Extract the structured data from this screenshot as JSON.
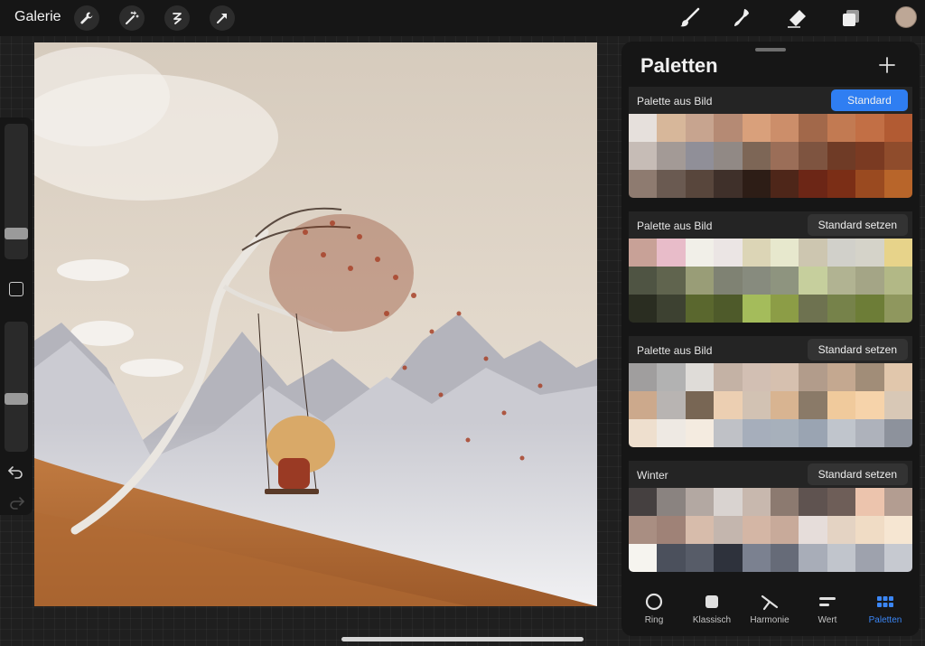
{
  "topbar": {
    "gallery_label": "Galerie",
    "left_tools": [
      "wrench-icon",
      "magic-wand-icon",
      "selection-icon",
      "transform-arrow-icon"
    ],
    "right_tools": [
      "brush-icon",
      "smudge-icon",
      "eraser-icon",
      "layers-icon"
    ],
    "current_color": "#bda796"
  },
  "sidebar": {
    "brush_size_level": 0.16,
    "opacity_level": 0.4
  },
  "panel": {
    "title": "Paletten",
    "palettes": [
      {
        "name": "Palette aus Bild",
        "button": "Standard",
        "is_default": true,
        "colors": [
          "#e6e0dc",
          "#d7b79a",
          "#c7a48f",
          "#b58a74",
          "#d9a07b",
          "#cc8e6a",
          "#a2684a",
          "#c27a52",
          "#c26f45",
          "#b25b33",
          "#c6bcb6",
          "#a39a96",
          "#908f98",
          "#918985",
          "#7d6656",
          "#9b6e58",
          "#7e5440",
          "#6f3b26",
          "#7a3a22",
          "#8f4c2c",
          "#8e7b70",
          "#6a5a51",
          "#58463c",
          "#3f302a",
          "#2d1d16",
          "#4e2619",
          "#6c2616",
          "#7b2e16",
          "#9a4a20",
          "#b8652a"
        ]
      },
      {
        "name": "Palette aus Bild",
        "button": "Standard setzen",
        "is_default": false,
        "colors": [
          "#c8a197",
          "#e8bcc9",
          "#f1efe8",
          "#ebe5e4",
          "#dcd5b6",
          "#e7e8cd",
          "#cdc6b0",
          "#d1d0ca",
          "#d5d3c9",
          "#e7d38a",
          "#4f5443",
          "#60644e",
          "#999d77",
          "#7f8273",
          "#878b7e",
          "#8e947f",
          "#c6cf9d",
          "#b1b392",
          "#a4a586",
          "#b2b886",
          "#2a2d21",
          "#3d4131",
          "#5a672e",
          "#4e5a2a",
          "#a4bc5b",
          "#8c9d46",
          "#6e7250",
          "#76824a",
          "#6d7d37",
          "#8f975e"
        ]
      },
      {
        "name": "Palette aus Bild",
        "button": "Standard setzen",
        "is_default": false,
        "colors": [
          "#a09e9e",
          "#b2b2b2",
          "#dfdcd8",
          "#c4b2a5",
          "#d2bfb3",
          "#d6c0af",
          "#b29c8b",
          "#c4a890",
          "#a18d78",
          "#e1c7ac",
          "#cca98c",
          "#b8b4b2",
          "#786654",
          "#eccfb2",
          "#d2c2b3",
          "#d8b491",
          "#8a7a68",
          "#f0ca9c",
          "#f6d3aa",
          "#d8c8b6",
          "#eedfce",
          "#eee9e3",
          "#f4ebe0",
          "#bfc1c6",
          "#a6aebb",
          "#a7b0bb",
          "#9aa4b2",
          "#c0c5cc",
          "#aeb2bb",
          "#8d929c"
        ]
      },
      {
        "name": "Winter",
        "button": "Standard setzen",
        "is_default": false,
        "colors": [
          "#454040",
          "#8a8380",
          "#b3a8a2",
          "#d9d3d0",
          "#c8b8ae",
          "#8c7a70",
          "#5f5350",
          "#6e5e58",
          "#ecc4ad",
          "#b39d91",
          "#a98e82",
          "#9f8277",
          "#d7bcab",
          "#c4b6ae",
          "#d4b6a5",
          "#c8aa9a",
          "#e6ddda",
          "#e4d3c3",
          "#f0dcc5",
          "#f6e6d2",
          "#f6f4ef",
          "#4b505c",
          "#575c68",
          "#2e323c",
          "#7b8190",
          "#666b78",
          "#a8adb8",
          "#c1c5cc",
          "#9ea2ad",
          "#c6c9d0"
        ]
      }
    ],
    "tabs": [
      {
        "label": "Ring",
        "icon": "ring-icon"
      },
      {
        "label": "Klassisch",
        "icon": "classic-square-icon"
      },
      {
        "label": "Harmonie",
        "icon": "harmony-icon"
      },
      {
        "label": "Wert",
        "icon": "value-sliders-icon"
      },
      {
        "label": "Paletten",
        "icon": "palettes-grid-icon"
      }
    ],
    "active_tab": "Paletten"
  },
  "colors": {
    "accent": "#2f7ef2",
    "panel_bg": "#161616",
    "app_bg": "#1f1f1f"
  }
}
